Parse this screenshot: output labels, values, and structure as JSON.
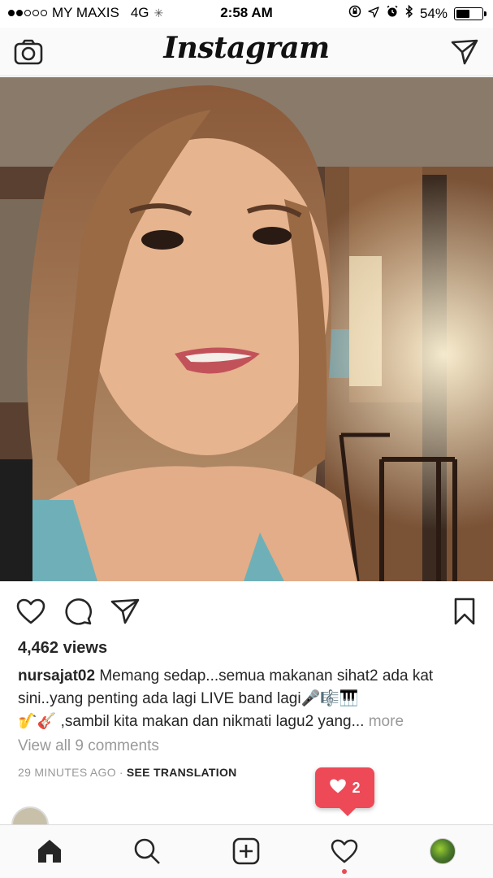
{
  "status_bar": {
    "carrier": "MY MAXIS",
    "network": "4G",
    "time": "2:58 AM",
    "battery": "54%",
    "battery_level": 0.54
  },
  "header": {
    "logo": "Instagram",
    "camera_icon": "camera-icon",
    "direct_icon": "paper-plane-icon"
  },
  "post": {
    "views": "4,462 views",
    "username": "nursajat02",
    "caption_line1": " Memang sedap...semua makanan sihat2 ada kat sini..yang penting ada lagi LIVE band lagi🎤🎼🎹",
    "caption_line2": "🎷🎸 ,sambil kita makan dan nikmati lagu2 yang...",
    "more": "more",
    "view_all_comments": "View all 9 comments",
    "time_ago": "29 MINUTES AGO",
    "separator": "·",
    "see_translation": "SEE TRANSLATION"
  },
  "like_notification": {
    "count": "2"
  },
  "tab_bar": {
    "items": [
      "home-icon",
      "search-icon",
      "add-post-icon",
      "activity-heart-icon",
      "profile-avatar"
    ]
  },
  "colors": {
    "accent_red": "#ed4956",
    "text": "#262626",
    "muted": "#999999"
  }
}
